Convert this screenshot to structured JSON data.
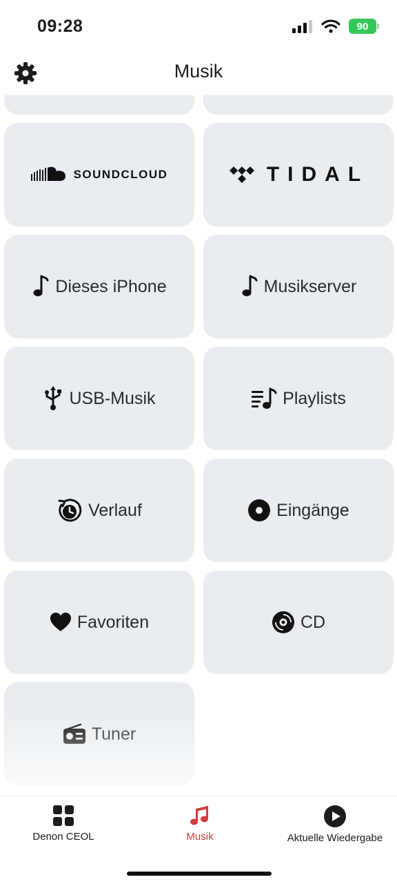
{
  "status_bar": {
    "time": "09:28",
    "battery": "90",
    "battery_color": "#34c759"
  },
  "header": {
    "title": "Musik",
    "settings_icon": "gear-icon"
  },
  "tiles": {
    "soundcloud": {
      "label": "SOUNDCLOUD",
      "icon": "soundcloud-logo"
    },
    "tidal": {
      "label": "TIDAL",
      "icon": "tidal-logo"
    },
    "this_iphone": {
      "label": "Dieses iPhone",
      "icon": "music-note-icon"
    },
    "music_server": {
      "label": "Musikserver",
      "icon": "music-note-icon"
    },
    "usb": {
      "label": "USB-Musik",
      "icon": "usb-icon"
    },
    "playlists": {
      "label": "Playlists",
      "icon": "playlist-icon"
    },
    "history": {
      "label": "Verlauf",
      "icon": "history-clock-icon"
    },
    "inputs": {
      "label": "Eingänge",
      "icon": "input-disc-icon"
    },
    "favorites": {
      "label": "Favoriten",
      "icon": "heart-icon"
    },
    "cd": {
      "label": "CD",
      "icon": "cd-icon"
    },
    "tuner": {
      "label": "Tuner",
      "icon": "radio-icon"
    }
  },
  "tabbar": {
    "tabs": [
      {
        "label": "Denon CEOL",
        "icon": "grid-icon"
      },
      {
        "label": "Musik",
        "icon": "music-notes-icon",
        "active": true
      },
      {
        "label": "Aktuelle Wiedergabe",
        "icon": "play-circle-icon"
      }
    ],
    "active_color": "#d33a3f"
  }
}
